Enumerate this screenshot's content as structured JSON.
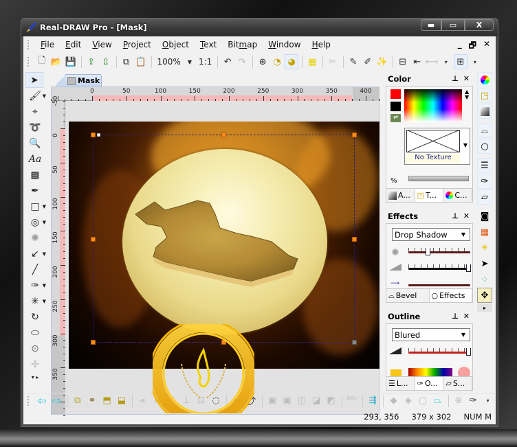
{
  "window": {
    "title": "Real-DRAW Pro - [Mask]",
    "controls": {
      "minimize": "▬",
      "maximize": "▭",
      "close": "X"
    }
  },
  "menubar": {
    "items": [
      {
        "label": "File",
        "accel": "F",
        "rest": "ile"
      },
      {
        "label": "Edit",
        "accel": "E",
        "rest": "dit"
      },
      {
        "label": "View",
        "accel": "V",
        "rest": "iew"
      },
      {
        "label": "Project",
        "accel": "P",
        "rest": "roject"
      },
      {
        "label": "Object",
        "accel": "O",
        "rest": "bject"
      },
      {
        "label": "Text",
        "accel": "T",
        "rest": "ext"
      },
      {
        "label": "Bitmap",
        "pre": "Bit",
        "accel": "m",
        "rest": "ap"
      },
      {
        "label": "Window",
        "accel": "W",
        "rest": "indow"
      },
      {
        "label": "Help",
        "accel": "H",
        "rest": "elp"
      }
    ],
    "mdi": {
      "minimize": "_",
      "restore": "🗗",
      "close": "✕"
    }
  },
  "toolbar": {
    "zoom_value": "100%",
    "zoom_ratio": "1:1",
    "buttons": [
      "new-document",
      "open-folder",
      "save",
      "import",
      "export",
      "copy",
      "paste",
      "undo",
      "redo",
      "add-object",
      "add-ellipse",
      "add-ellipse-plus",
      "selection-grid",
      "clip",
      "eyedropper",
      "magic-eyedropper",
      "magic-wand",
      "shrink",
      "arrow-left-box",
      "text-align"
    ]
  },
  "document": {
    "tab_label": "Mask",
    "ruler_h_labels": [
      "0",
      "50",
      "100",
      "150",
      "200",
      "250",
      "300",
      "350",
      "400"
    ],
    "ruler_v_labels": [
      "-50",
      "0",
      "50",
      "100",
      "150",
      "200",
      "250",
      "300",
      "350"
    ]
  },
  "color_panel": {
    "title": "Color",
    "primary_color": "#ff0000",
    "secondary_color": "#000000",
    "texture_label": "No Texture",
    "opacity_label": "%",
    "tabs": [
      {
        "label": "A...",
        "icon": "gradient-icon"
      },
      {
        "label": "T...",
        "icon": "texture-icon"
      },
      {
        "label": "C...",
        "icon": "color-wheel-icon"
      }
    ]
  },
  "effects_panel": {
    "title": "Effects",
    "selected": "Drop Shadow",
    "slider1_value": 0.3,
    "slider2_value": 1.0,
    "tabs": [
      {
        "label": "Bevel",
        "icon": "bevel-icon"
      },
      {
        "label": "Effects",
        "icon": "effects-circle-icon"
      }
    ]
  },
  "outline_panel": {
    "title": "Outline",
    "selected": "Blured",
    "slider_value": 1.0,
    "tabs": [
      {
        "label": "L...",
        "icon": "layers-icon"
      },
      {
        "label": "O...",
        "icon": "outline-pen-icon"
      },
      {
        "label": "S...",
        "icon": "shadow-icon"
      }
    ]
  },
  "statusbar": {
    "coords": "293, 356",
    "size": "379 x 302",
    "mode": "NUM M"
  },
  "colors": {
    "accent_handle": "#ff8c1a",
    "ruler_highlight": "#f4b9b9"
  }
}
